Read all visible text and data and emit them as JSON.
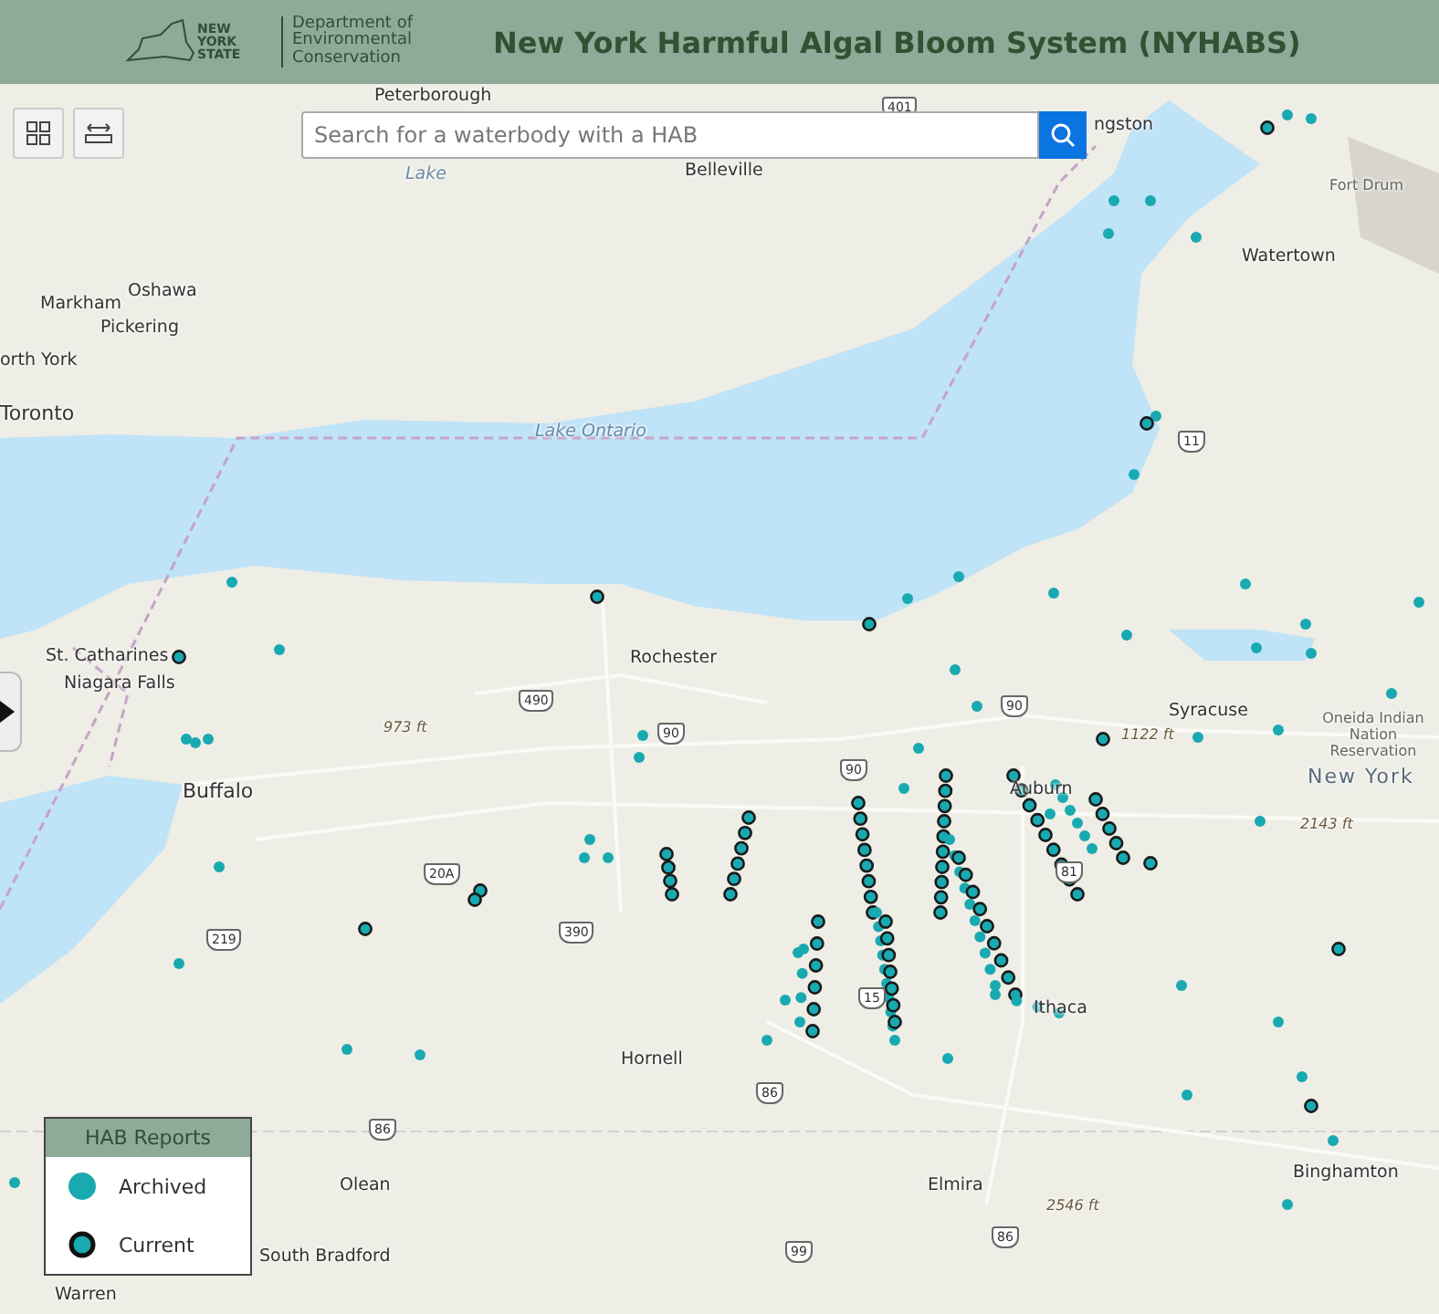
{
  "header": {
    "logo_state": "NEW YORK STATE",
    "agency": "Department of Environmental Conservation",
    "title": "New York Harmful Algal Bloom System (NYHABS)"
  },
  "search": {
    "placeholder": "Search for a waterbody with a HAB"
  },
  "map_labels": [
    {
      "text": "Peterborough",
      "kind": "city"
    },
    {
      "text": "Belleville",
      "kind": "city"
    },
    {
      "text": "Lake",
      "kind": "water"
    },
    {
      "text": "ngston",
      "kind": "city"
    },
    {
      "text": "Fort Drum",
      "kind": "region"
    },
    {
      "text": "Watertown",
      "kind": "city"
    },
    {
      "text": "Oshawa",
      "kind": "city"
    },
    {
      "text": "Markham",
      "kind": "city"
    },
    {
      "text": "Pickering",
      "kind": "city"
    },
    {
      "text": "orth York",
      "kind": "city"
    },
    {
      "text": "Toronto",
      "kind": "bigcity"
    },
    {
      "text": "Lake Ontario",
      "kind": "water"
    },
    {
      "text": "St. Catharines",
      "kind": "city"
    },
    {
      "text": "Niagara Falls",
      "kind": "city"
    },
    {
      "text": "Rochester",
      "kind": "city"
    },
    {
      "text": "Syracuse",
      "kind": "city"
    },
    {
      "text": "Oneida Indian Nation Reservation",
      "kind": "region"
    },
    {
      "text": "Auburn",
      "kind": "city"
    },
    {
      "text": "1122 ft",
      "kind": "elevation"
    },
    {
      "text": "New York",
      "kind": "state"
    },
    {
      "text": "2143 ft",
      "kind": "elevation"
    },
    {
      "text": "973 ft",
      "kind": "elevation"
    },
    {
      "text": "Buffalo",
      "kind": "bigcity"
    },
    {
      "text": "Hornell",
      "kind": "city"
    },
    {
      "text": "Ithaca",
      "kind": "city"
    },
    {
      "text": "Olean",
      "kind": "city"
    },
    {
      "text": "2546 ft",
      "kind": "elevation"
    },
    {
      "text": "Elmira",
      "kind": "city"
    },
    {
      "text": "Binghamton",
      "kind": "city"
    },
    {
      "text": "South Bradford",
      "kind": "city"
    },
    {
      "text": "Warren",
      "kind": "city"
    }
  ],
  "highway_shields": [
    "401",
    "11",
    "490",
    "90",
    "90",
    "20A",
    "219",
    "390",
    "86",
    "86",
    "99",
    "15",
    "81",
    "86",
    "90"
  ],
  "legend": {
    "title": "HAB Reports",
    "items": [
      {
        "label": "Archived",
        "kind": "archived"
      },
      {
        "label": "Current",
        "kind": "current"
      }
    ]
  }
}
